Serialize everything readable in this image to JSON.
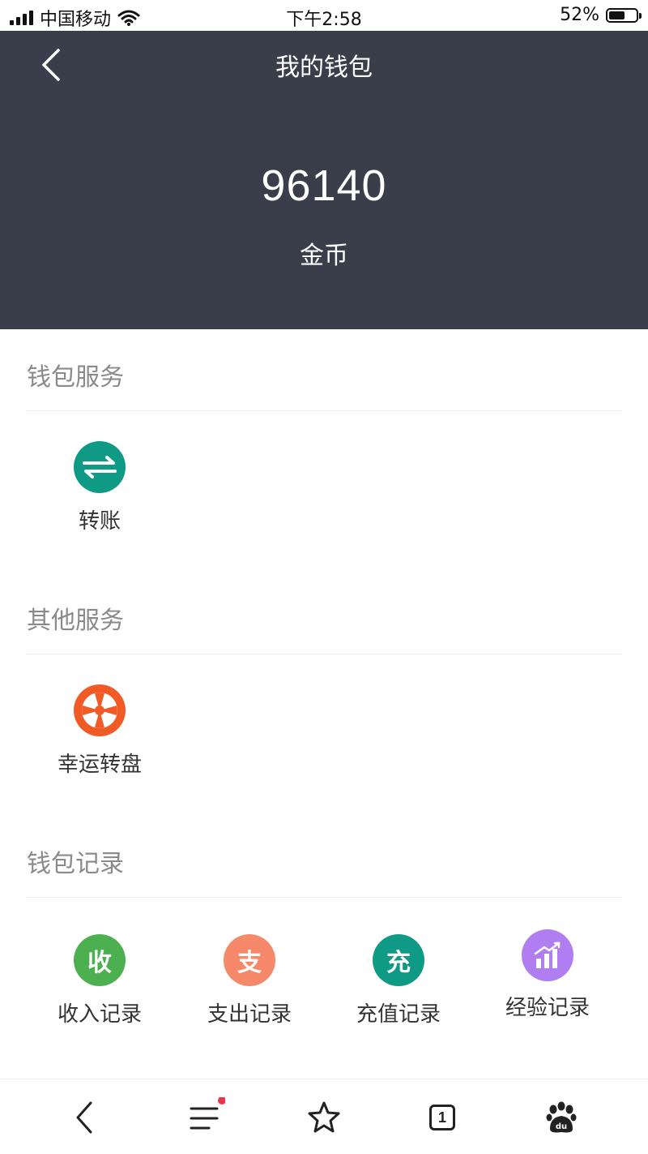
{
  "status_bar": {
    "carrier": "中国移动",
    "time": "下午2:58",
    "battery": "52%"
  },
  "header": {
    "title": "我的钱包",
    "balance": "96140",
    "unit": "金币"
  },
  "sections": [
    {
      "title": "钱包服务",
      "items": [
        {
          "label": "转账",
          "icon": "transfer-icon",
          "color": "#0e9a85"
        }
      ]
    },
    {
      "title": "其他服务",
      "items": [
        {
          "label": "幸运转盘",
          "icon": "wheel-icon",
          "color": "#f15a24"
        }
      ]
    },
    {
      "title": "钱包记录",
      "items": [
        {
          "label": "收入记录",
          "icon_text": "收",
          "color": "#4caf50"
        },
        {
          "label": "支出记录",
          "icon_text": "支",
          "color": "#f5896a"
        },
        {
          "label": "充值记录",
          "icon_text": "充",
          "color": "#0e9a85"
        },
        {
          "label": "经验记录",
          "icon": "chart-icon",
          "color": "#b07ef0"
        }
      ]
    }
  ],
  "bottom_bar": {
    "tab_count": "1",
    "items": [
      "back-icon",
      "menu-icon",
      "star-icon",
      "tabs-icon",
      "paw-icon"
    ]
  }
}
